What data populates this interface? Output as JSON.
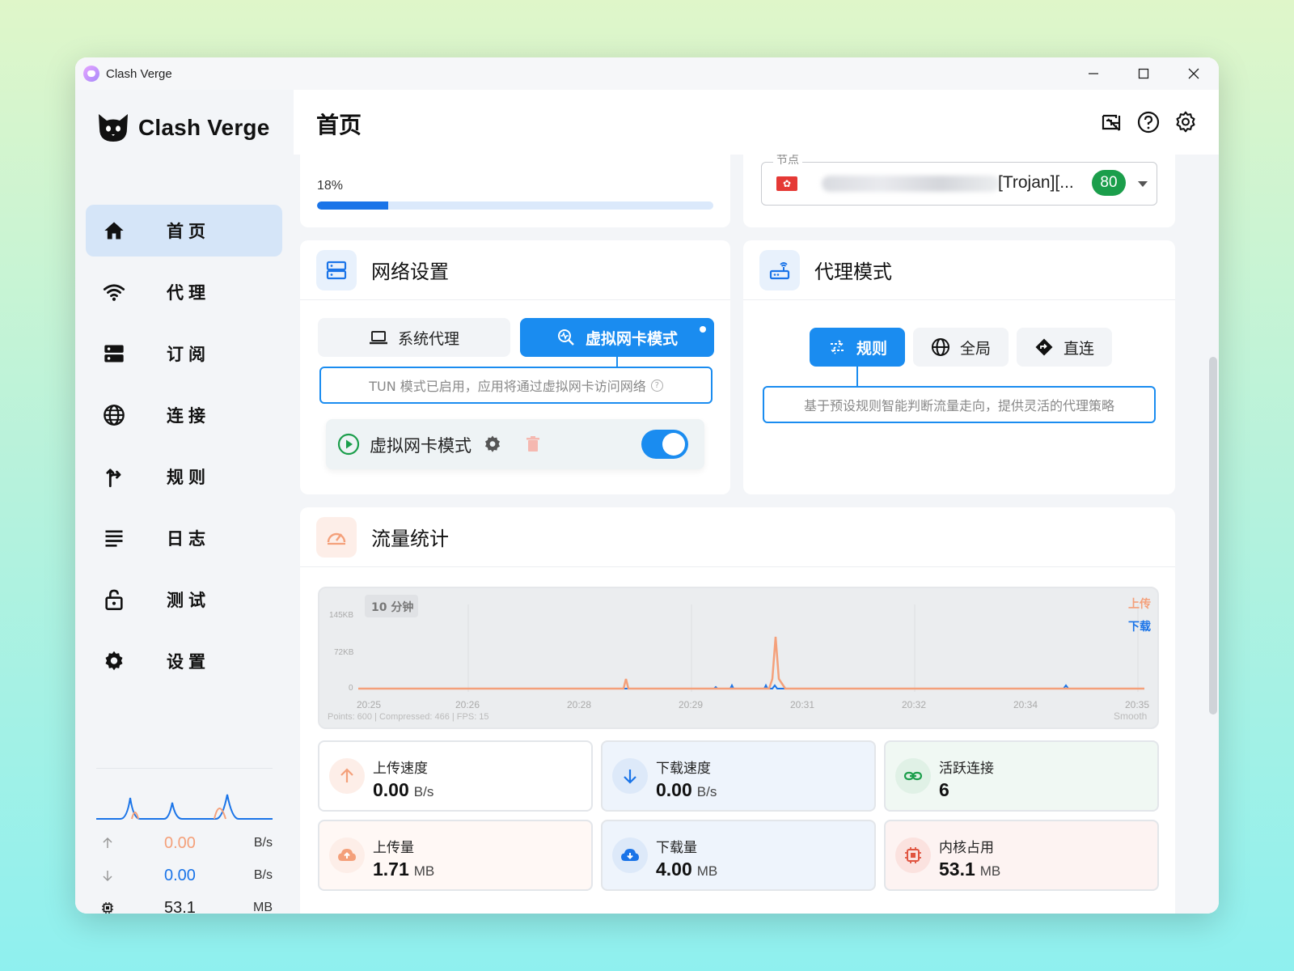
{
  "window": {
    "title": "Clash Verge"
  },
  "sidebar": {
    "brand": "Clash Verge",
    "items": [
      {
        "label": "首页",
        "icon": "home-icon"
      },
      {
        "label": "代理",
        "icon": "wifi-icon"
      },
      {
        "label": "订阅",
        "icon": "dns-icon"
      },
      {
        "label": "连接",
        "icon": "globe-icon"
      },
      {
        "label": "规则",
        "icon": "fork-icon"
      },
      {
        "label": "日志",
        "icon": "list-icon"
      },
      {
        "label": "测试",
        "icon": "lock-icon"
      },
      {
        "label": "设置",
        "icon": "gear-icon"
      }
    ],
    "stats": {
      "upload": {
        "value": "0.00",
        "unit": "B/s"
      },
      "download": {
        "value": "0.00",
        "unit": "B/s"
      },
      "memory": {
        "value": "53.1",
        "unit": "MB"
      }
    }
  },
  "header": {
    "title": "首页"
  },
  "top_left_card": {
    "progress_text": "18%",
    "progress": 0.18
  },
  "top_right_card": {
    "node_legend": "节点",
    "node_name": "[Trojan][...",
    "latency": "80"
  },
  "network_card": {
    "title": "网络设置",
    "system_proxy_label": "系统代理",
    "tun_label": "虚拟网卡模式",
    "info": "TUN 模式已启用，应用将通过虚拟网卡访问网络",
    "tun_row_label": "虚拟网卡模式",
    "tun_enabled": true
  },
  "proxy_mode_card": {
    "title": "代理模式",
    "modes": [
      "规则",
      "全局",
      "直连"
    ],
    "active": "规则",
    "info": "基于预设规则智能判断流量走向，提供灵活的代理策略"
  },
  "traffic_card": {
    "title": "流量统计",
    "chart_data": {
      "type": "line",
      "range_label": "10 分钟",
      "y_ticks": [
        "145KB",
        "72KB",
        "0"
      ],
      "x_ticks": [
        "20:25",
        "20:26",
        "20:28",
        "20:29",
        "20:31",
        "20:32",
        "20:34",
        "20:35"
      ],
      "legend": [
        "上传",
        "下载"
      ],
      "footer_left": "Points: 600 | Compressed: 466 | FPS: 15",
      "footer_right": "Smooth",
      "colors": {
        "upload": "#f4a07a",
        "download": "#1a74e8"
      }
    },
    "stats": [
      {
        "label": "上传速度",
        "value": "0.00",
        "unit": "B/s",
        "icon": "arrow-up-icon"
      },
      {
        "label": "下载速度",
        "value": "0.00",
        "unit": "B/s",
        "icon": "arrow-down-icon"
      },
      {
        "label": "活跃连接",
        "value": "6",
        "unit": "",
        "icon": "link-icon"
      },
      {
        "label": "上传量",
        "value": "1.71",
        "unit": "MB",
        "icon": "cloud-upload-icon"
      },
      {
        "label": "下载量",
        "value": "4.00",
        "unit": "MB",
        "icon": "cloud-download-icon"
      },
      {
        "label": "内核占用",
        "value": "53.1",
        "unit": "MB",
        "icon": "chip-icon"
      }
    ]
  }
}
